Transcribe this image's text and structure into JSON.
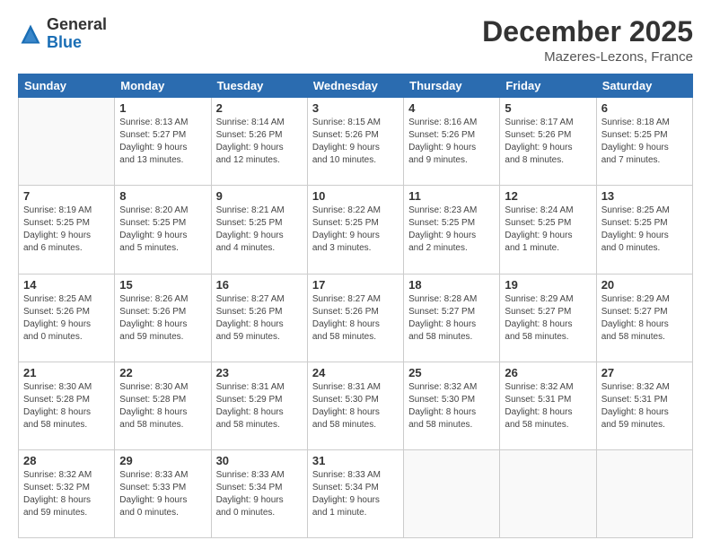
{
  "logo": {
    "line1": "General",
    "line2": "Blue"
  },
  "header": {
    "month": "December 2025",
    "location": "Mazeres-Lezons, France"
  },
  "days_of_week": [
    "Sunday",
    "Monday",
    "Tuesday",
    "Wednesday",
    "Thursday",
    "Friday",
    "Saturday"
  ],
  "weeks": [
    [
      {
        "day": "",
        "info": ""
      },
      {
        "day": "1",
        "info": "Sunrise: 8:13 AM\nSunset: 5:27 PM\nDaylight: 9 hours\nand 13 minutes."
      },
      {
        "day": "2",
        "info": "Sunrise: 8:14 AM\nSunset: 5:26 PM\nDaylight: 9 hours\nand 12 minutes."
      },
      {
        "day": "3",
        "info": "Sunrise: 8:15 AM\nSunset: 5:26 PM\nDaylight: 9 hours\nand 10 minutes."
      },
      {
        "day": "4",
        "info": "Sunrise: 8:16 AM\nSunset: 5:26 PM\nDaylight: 9 hours\nand 9 minutes."
      },
      {
        "day": "5",
        "info": "Sunrise: 8:17 AM\nSunset: 5:26 PM\nDaylight: 9 hours\nand 8 minutes."
      },
      {
        "day": "6",
        "info": "Sunrise: 8:18 AM\nSunset: 5:25 PM\nDaylight: 9 hours\nand 7 minutes."
      }
    ],
    [
      {
        "day": "7",
        "info": "Sunrise: 8:19 AM\nSunset: 5:25 PM\nDaylight: 9 hours\nand 6 minutes."
      },
      {
        "day": "8",
        "info": "Sunrise: 8:20 AM\nSunset: 5:25 PM\nDaylight: 9 hours\nand 5 minutes."
      },
      {
        "day": "9",
        "info": "Sunrise: 8:21 AM\nSunset: 5:25 PM\nDaylight: 9 hours\nand 4 minutes."
      },
      {
        "day": "10",
        "info": "Sunrise: 8:22 AM\nSunset: 5:25 PM\nDaylight: 9 hours\nand 3 minutes."
      },
      {
        "day": "11",
        "info": "Sunrise: 8:23 AM\nSunset: 5:25 PM\nDaylight: 9 hours\nand 2 minutes."
      },
      {
        "day": "12",
        "info": "Sunrise: 8:24 AM\nSunset: 5:25 PM\nDaylight: 9 hours\nand 1 minute."
      },
      {
        "day": "13",
        "info": "Sunrise: 8:25 AM\nSunset: 5:25 PM\nDaylight: 9 hours\nand 0 minutes."
      }
    ],
    [
      {
        "day": "14",
        "info": "Sunrise: 8:25 AM\nSunset: 5:26 PM\nDaylight: 9 hours\nand 0 minutes."
      },
      {
        "day": "15",
        "info": "Sunrise: 8:26 AM\nSunset: 5:26 PM\nDaylight: 8 hours\nand 59 minutes."
      },
      {
        "day": "16",
        "info": "Sunrise: 8:27 AM\nSunset: 5:26 PM\nDaylight: 8 hours\nand 59 minutes."
      },
      {
        "day": "17",
        "info": "Sunrise: 8:27 AM\nSunset: 5:26 PM\nDaylight: 8 hours\nand 58 minutes."
      },
      {
        "day": "18",
        "info": "Sunrise: 8:28 AM\nSunset: 5:27 PM\nDaylight: 8 hours\nand 58 minutes."
      },
      {
        "day": "19",
        "info": "Sunrise: 8:29 AM\nSunset: 5:27 PM\nDaylight: 8 hours\nand 58 minutes."
      },
      {
        "day": "20",
        "info": "Sunrise: 8:29 AM\nSunset: 5:27 PM\nDaylight: 8 hours\nand 58 minutes."
      }
    ],
    [
      {
        "day": "21",
        "info": "Sunrise: 8:30 AM\nSunset: 5:28 PM\nDaylight: 8 hours\nand 58 minutes."
      },
      {
        "day": "22",
        "info": "Sunrise: 8:30 AM\nSunset: 5:28 PM\nDaylight: 8 hours\nand 58 minutes."
      },
      {
        "day": "23",
        "info": "Sunrise: 8:31 AM\nSunset: 5:29 PM\nDaylight: 8 hours\nand 58 minutes."
      },
      {
        "day": "24",
        "info": "Sunrise: 8:31 AM\nSunset: 5:30 PM\nDaylight: 8 hours\nand 58 minutes."
      },
      {
        "day": "25",
        "info": "Sunrise: 8:32 AM\nSunset: 5:30 PM\nDaylight: 8 hours\nand 58 minutes."
      },
      {
        "day": "26",
        "info": "Sunrise: 8:32 AM\nSunset: 5:31 PM\nDaylight: 8 hours\nand 58 minutes."
      },
      {
        "day": "27",
        "info": "Sunrise: 8:32 AM\nSunset: 5:31 PM\nDaylight: 8 hours\nand 59 minutes."
      }
    ],
    [
      {
        "day": "28",
        "info": "Sunrise: 8:32 AM\nSunset: 5:32 PM\nDaylight: 8 hours\nand 59 minutes."
      },
      {
        "day": "29",
        "info": "Sunrise: 8:33 AM\nSunset: 5:33 PM\nDaylight: 9 hours\nand 0 minutes."
      },
      {
        "day": "30",
        "info": "Sunrise: 8:33 AM\nSunset: 5:34 PM\nDaylight: 9 hours\nand 0 minutes."
      },
      {
        "day": "31",
        "info": "Sunrise: 8:33 AM\nSunset: 5:34 PM\nDaylight: 9 hours\nand 1 minute."
      },
      {
        "day": "",
        "info": ""
      },
      {
        "day": "",
        "info": ""
      },
      {
        "day": "",
        "info": ""
      }
    ]
  ]
}
